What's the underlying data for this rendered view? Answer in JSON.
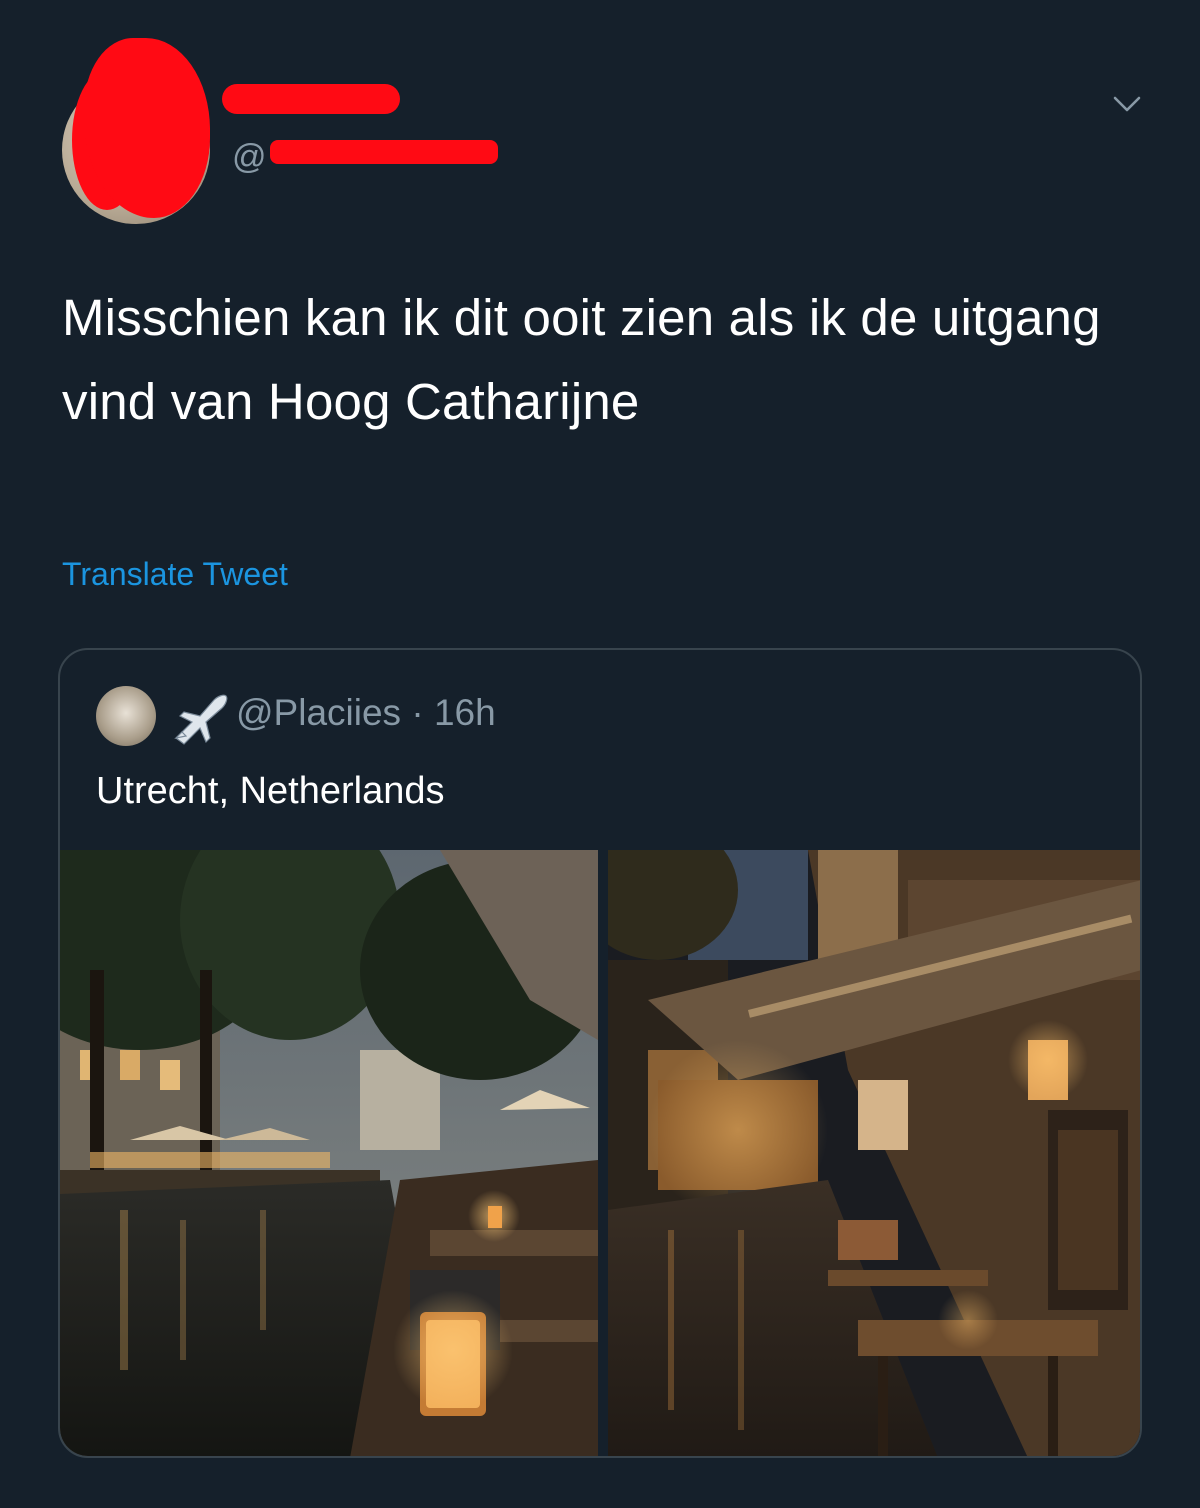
{
  "tweet": {
    "handle_prefix": "@",
    "text": "Misschien kan ik dit ooit zien als ik de uitgang vind van Hoog Catharijne",
    "translate_label": "Translate Tweet",
    "menu_icon": "chevron-down-icon"
  },
  "quoted": {
    "handle": "@Placiies",
    "separator": "·",
    "time": "16h",
    "text": "Utrecht, Netherlands",
    "emoji_icon": "airplane-icon"
  },
  "colors": {
    "background": "#15202b",
    "accent": "#1b95e0",
    "secondary_text": "#8899a6",
    "border": "#38444d",
    "redaction": "#ff0a14"
  }
}
